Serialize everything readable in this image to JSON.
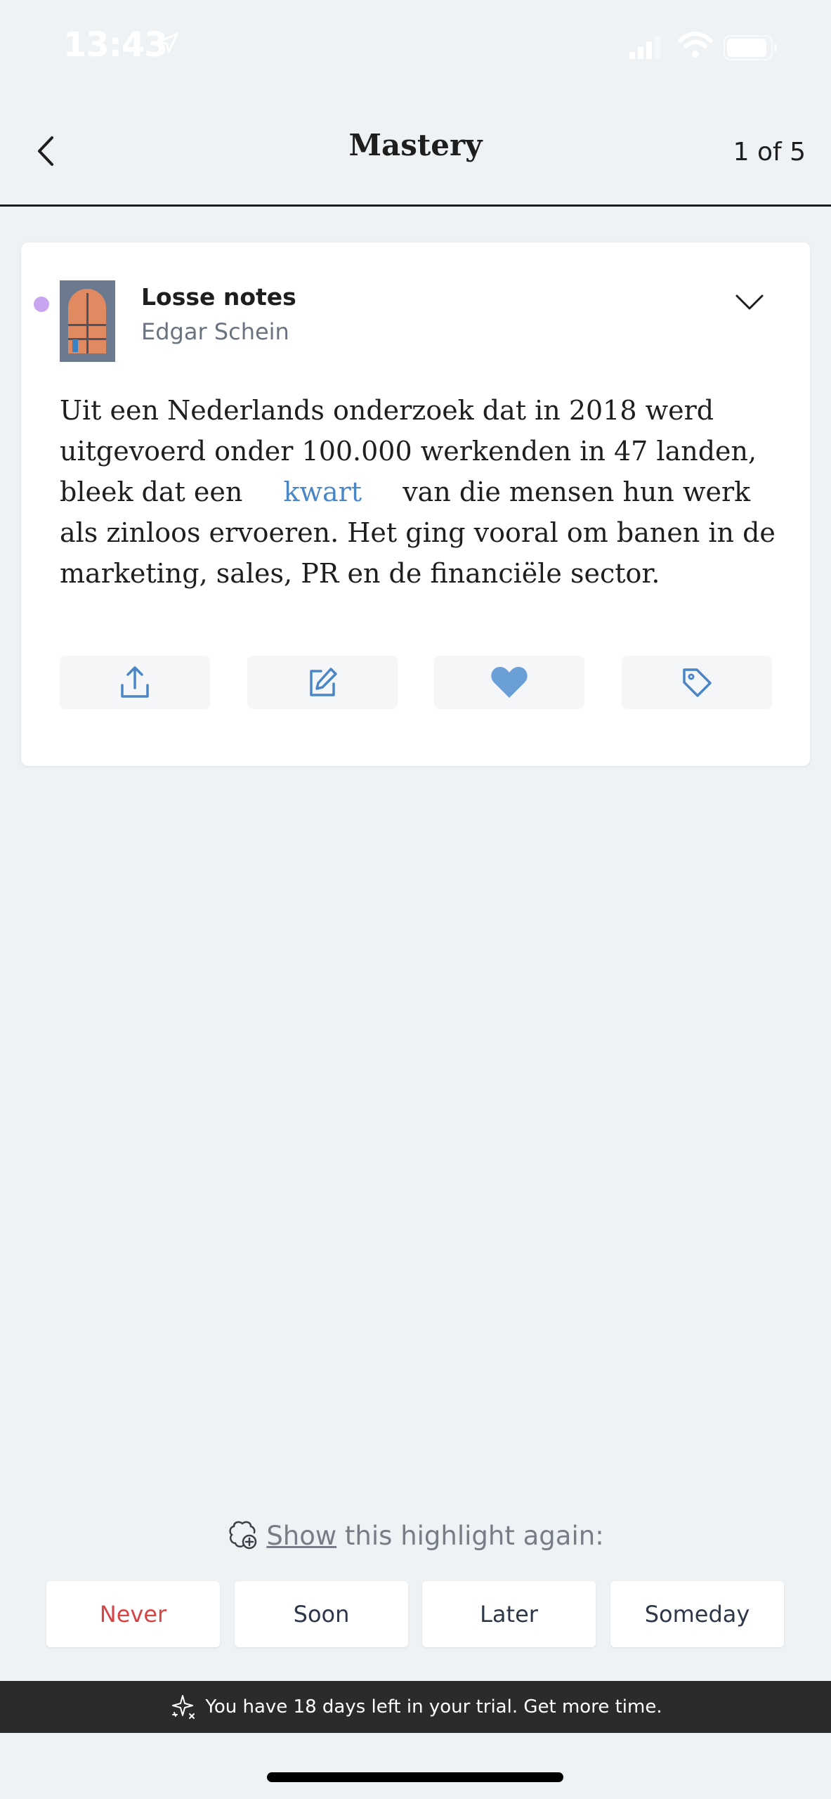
{
  "status_bar": {
    "time": "13:43"
  },
  "header": {
    "title": "Mastery",
    "page_indicator": "1 of 5"
  },
  "highlight": {
    "source_title": "Losse notes",
    "author": "Edgar Schein",
    "text_before": "Uit een Nederlands onderzoek dat in 2018 werd uitgevoerd onder 100.000 werkenden in 47 landen, bleek dat een",
    "highlighted_word": "kwart",
    "text_after": "van die mensen hun werk als zinloos ervoeren. Het ging vooral om banen in de marketing, sales, PR en de financiële sector.",
    "actions": [
      "share-icon",
      "edit-icon",
      "heart-icon",
      "tag-icon"
    ],
    "favorited": true
  },
  "review": {
    "prompt_link": "Show",
    "prompt_rest": "this highlight again:",
    "options": [
      "Never",
      "Soon",
      "Later",
      "Someday"
    ]
  },
  "trial_banner": {
    "text": "You have 18 days left in your trial. Get more time."
  },
  "colors": {
    "accent": "#4a86c6",
    "heart": "#6a9fd8",
    "never": "#d64545",
    "background": "#eff2f5",
    "dot": "#c7a6ef"
  }
}
